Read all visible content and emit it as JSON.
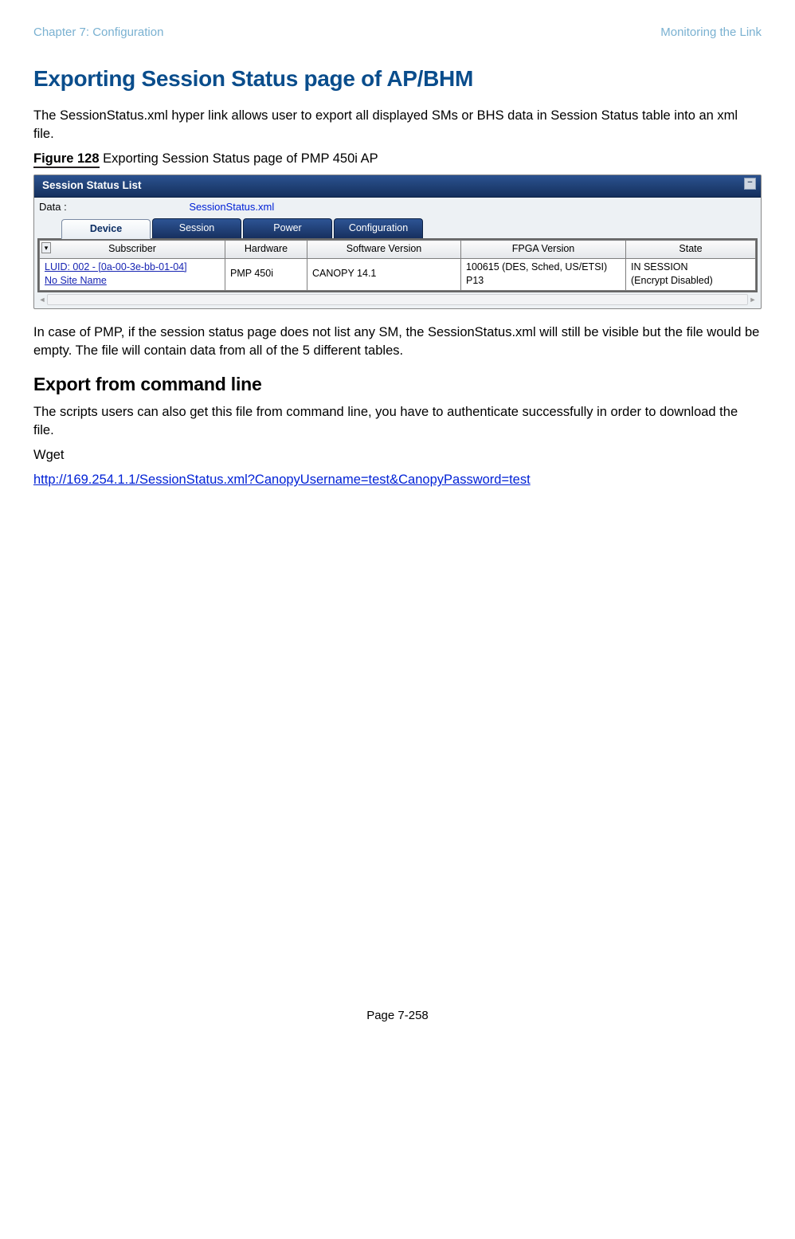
{
  "header": {
    "left": "Chapter 7:  Configuration",
    "right": "Monitoring the Link"
  },
  "h1": "Exporting Session Status page of AP/BHM",
  "p1": "The SessionStatus.xml hyper link allows user to export all displayed SMs or BHS data in Session Status table into an xml file.",
  "figure": {
    "num": "Figure 128",
    "caption": " Exporting Session Status page of PMP 450i AP"
  },
  "screenshot": {
    "title": "Session Status List",
    "data_label": "Data :",
    "data_link": "SessionStatus.xml",
    "tabs": [
      "Device",
      "Session",
      "Power",
      "Configuration"
    ],
    "headers": [
      "Subscriber",
      "Hardware",
      "Software Version",
      "FPGA Version",
      "State"
    ],
    "row": {
      "sub1": "LUID: 002 - [0a-00-3e-bb-01-04]",
      "sub2": "No Site Name",
      "hw": "PMP 450i",
      "sw": "CANOPY 14.1",
      "fpga": "100615 (DES, Sched, US/ETSI) P13",
      "state1": "IN SESSION",
      "state2": "(Encrypt Disabled)"
    }
  },
  "p2": "In case of PMP, if the session status page does not list any SM, the SessionStatus.xml will still be visible but the file would be empty. The file will contain data from all of the 5 different tables.",
  "h2": "Export from command line",
  "p3": "The scripts users can also get this file from command line, you have to authenticate successfully in order to download the file.",
  "p4": "Wget",
  "url": "http://169.254.1.1/SessionStatus.xml?CanopyUsername=test&CanopyPassword=test",
  "pagenum": "Page 7-258"
}
